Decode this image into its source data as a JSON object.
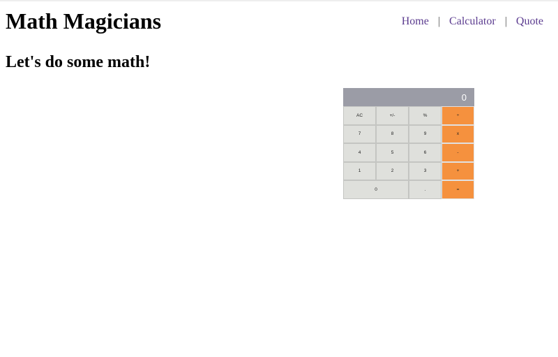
{
  "header": {
    "title": "Math Magicians",
    "nav": {
      "home": "Home",
      "calculator": "Calculator",
      "quote": "Quote",
      "separator": "|"
    }
  },
  "main": {
    "heading": "Let's do some math!"
  },
  "calculator": {
    "display_value": "0",
    "keys": {
      "ac": "AC",
      "plus_minus": "+/-",
      "percent": "%",
      "divide": "÷",
      "seven": "7",
      "eight": "8",
      "nine": "9",
      "multiply": "x",
      "four": "4",
      "five": "5",
      "six": "6",
      "minus": "-",
      "one": "1",
      "two": "2",
      "three": "3",
      "plus": "+",
      "zero": "0",
      "dot": ".",
      "equals": "="
    },
    "colors": {
      "display_bg": "#9b9ca6",
      "key_bg": "#dfe0dc",
      "operator_bg": "#f5913e"
    }
  }
}
